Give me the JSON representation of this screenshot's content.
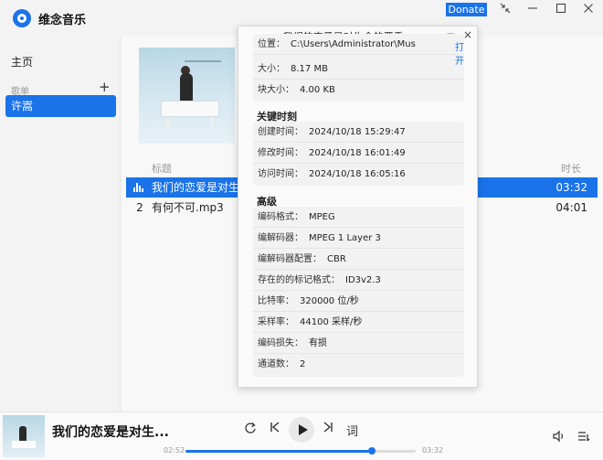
{
  "app": {
    "name": "维念音乐"
  },
  "titlebar": {
    "donate_label": "Donate",
    "icons": [
      "shrink-icon",
      "minimize-icon",
      "maximize-icon",
      "close-icon"
    ]
  },
  "sidebar": {
    "home_label": "主页",
    "playlists_section": "歌单",
    "add_label": "+",
    "items": [
      {
        "label": "许嵩",
        "selected": true
      }
    ]
  },
  "track_list": {
    "col_title": "标题",
    "col_duration": "时长",
    "rows": [
      {
        "num": "",
        "title": "我们的恋爱是对生命",
        "duration": "03:32",
        "active": true
      },
      {
        "num": "2",
        "title": "有何不可.mp3",
        "duration": "04:01",
        "active": false
      }
    ]
  },
  "dialog": {
    "title": "我们的恋爱是对生命的严重...",
    "minimize_label": "−",
    "close_label": "×",
    "file": {
      "location_label": "位置：",
      "location_value": "C:\\Users\\Administrator\\Mus",
      "open_label": "打开",
      "size_label": "大小：",
      "size_value": "8.17 MB",
      "block_label": "块大小：",
      "block_value": "4.00 KB"
    },
    "times_section": "关键时刻",
    "times": [
      {
        "label": "创建时间：",
        "value": "2024/10/18 15:29:47"
      },
      {
        "label": "修改时间：",
        "value": "2024/10/18 16:01:49"
      },
      {
        "label": "访问时间：",
        "value": "2024/10/18 16:05:16"
      }
    ],
    "advanced_section": "高级",
    "advanced": [
      {
        "label": "编码格式：",
        "value": "MPEG"
      },
      {
        "label": "编解码器：",
        "value": "MPEG 1 Layer 3"
      },
      {
        "label": "编解码器配置：",
        "value": "CBR"
      },
      {
        "label": "存在的的标记格式：",
        "value": "ID3v2.3"
      },
      {
        "label": "比特率：",
        "value": "320000 位/秒"
      },
      {
        "label": "采样率：",
        "value": "44100 采样/秒"
      },
      {
        "label": "编码损失：",
        "value": "有损"
      },
      {
        "label": "通道数：",
        "value": "2"
      }
    ]
  },
  "player": {
    "now_playing": "我们的恋爱是对生...",
    "elapsed": "02:52",
    "total": "03:32",
    "progress": 0.81,
    "lyrics_label": "词",
    "accent_color": "#1a73e8"
  }
}
